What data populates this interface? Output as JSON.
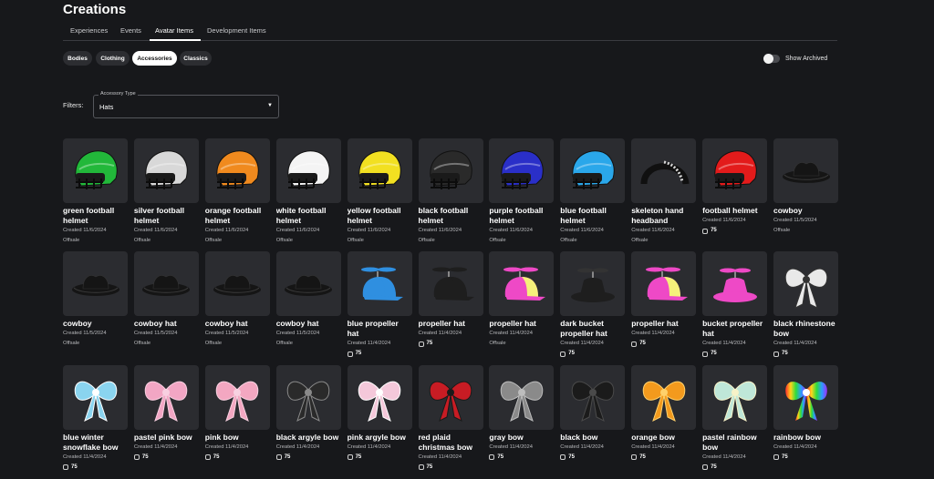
{
  "page": {
    "title": "Creations"
  },
  "tabs": [
    "Experiences",
    "Events",
    "Avatar Items",
    "Development Items"
  ],
  "active_tab": "Avatar Items",
  "categories": [
    "Bodies",
    "Clothing",
    "Accessories",
    "Classics"
  ],
  "active_category": "Accessories",
  "show_archived": {
    "label": "Show Archived",
    "enabled": false
  },
  "filters": {
    "label": "Filters:",
    "select_label": "Accessory Type",
    "select_value": "Hats"
  },
  "items": [
    {
      "name": "green football helmet",
      "created": "Created 11/6/2024",
      "status": "Offsale",
      "icon": "helmet",
      "color": "#22b83a"
    },
    {
      "name": "silver football helmet",
      "created": "Created 11/6/2024",
      "status": "Offsale",
      "icon": "helmet",
      "color": "#d8d8d8"
    },
    {
      "name": "orange football helmet",
      "created": "Created 11/6/2024",
      "status": "Offsale",
      "icon": "helmet",
      "color": "#f08a1e"
    },
    {
      "name": "white football helmet",
      "created": "Created 11/6/2024",
      "status": "Offsale",
      "icon": "helmet",
      "color": "#f4f4f4"
    },
    {
      "name": "yellow football helmet",
      "created": "Created 11/6/2024",
      "status": "Offsale",
      "icon": "helmet",
      "color": "#f2e021"
    },
    {
      "name": "black football helmet",
      "created": "Created 11/6/2024",
      "status": "Offsale",
      "icon": "helmet",
      "color": "#2a2a2a"
    },
    {
      "name": "purple football helmet",
      "created": "Created 11/6/2024",
      "status": "Offsale",
      "icon": "helmet",
      "color": "#2a2fc8"
    },
    {
      "name": "blue football helmet",
      "created": "Created 11/6/2024",
      "status": "Offsale",
      "icon": "helmet",
      "color": "#2aa7ea"
    },
    {
      "name": "skeleton hand headband",
      "created": "Created 11/6/2024",
      "status": "Offsale",
      "icon": "headband",
      "color": "#1a1a1a"
    },
    {
      "name": "football helmet",
      "created": "Created 11/6/2024",
      "price": "75",
      "icon": "helmet",
      "color": "#e31b1b"
    },
    {
      "name": "cowboy",
      "created": "Created 11/5/2024",
      "status": "Offsale",
      "icon": "cowboy",
      "color": "#151515"
    },
    {
      "name": "cowboy",
      "created": "Created 11/5/2024",
      "status": "Offsale",
      "icon": "cowboy",
      "color": "#151515"
    },
    {
      "name": "cowboy hat",
      "created": "Created 11/5/2024",
      "status": "Offsale",
      "icon": "cowboy",
      "color": "#151515"
    },
    {
      "name": "cowboy hat",
      "created": "Created 11/5/2024",
      "status": "Offsale",
      "icon": "cowboy",
      "color": "#151515"
    },
    {
      "name": "cowboy hat",
      "created": "Created 11/5/2024",
      "status": "Offsale",
      "icon": "cowboy",
      "color": "#151515"
    },
    {
      "name": "blue propeller hat",
      "created": "Created 11/4/2024",
      "price": "75",
      "icon": "propeller",
      "color": "#2f8fe0",
      "color2": "#2f8fe0"
    },
    {
      "name": "propeller hat",
      "created": "Created 11/4/2024",
      "price": "75",
      "icon": "propeller",
      "color": "#1e1e1e",
      "color2": "#1e1e1e"
    },
    {
      "name": "propeller hat",
      "created": "Created 11/4/2024",
      "status": "Offsale",
      "icon": "propeller",
      "color": "#ee49c6",
      "color2": "#f5f07a"
    },
    {
      "name": "dark bucket propeller hat",
      "created": "Created 11/4/2024",
      "price": "75",
      "icon": "bucket",
      "color": "#1e1e1e"
    },
    {
      "name": "propeller hat",
      "created": "Created 11/4/2024",
      "price": "75",
      "icon": "propeller",
      "color": "#ee49c6",
      "color2": "#f5f07a"
    },
    {
      "name": "bucket propeller hat",
      "created": "Created 11/4/2024",
      "price": "75",
      "icon": "bucket",
      "color": "#ee49c6"
    },
    {
      "name": "black rhinestone bow",
      "created": "Created 11/4/2024",
      "price": "75",
      "icon": "bow",
      "color": "#e9e9e9",
      "color2": "#333333"
    },
    {
      "name": "blue winter snowflake bow",
      "created": "Created 11/4/2024",
      "price": "75",
      "icon": "bow",
      "color": "#8ad4ef",
      "color2": "#ffffff"
    },
    {
      "name": "pastel pink bow",
      "created": "Created 11/4/2024",
      "price": "75",
      "icon": "bow",
      "color": "#f2a6c4",
      "color2": "#f8cfe0"
    },
    {
      "name": "pink bow",
      "created": "Created 11/4/2024",
      "price": "75",
      "icon": "bow",
      "color": "#f3a7c1",
      "color2": "#f8d2e1"
    },
    {
      "name": "black argyle bow",
      "created": "Created 11/4/2024",
      "price": "75",
      "icon": "bow",
      "color": "#2a2a2a",
      "color2": "#8a8a8a"
    },
    {
      "name": "pink argyle bow",
      "created": "Created 11/4/2024",
      "price": "75",
      "icon": "bow",
      "color": "#f4c8da",
      "color2": "#ffffff"
    },
    {
      "name": "red plaid christmas bow",
      "created": "Created 11/4/2024",
      "price": "75",
      "icon": "bow",
      "color": "#c81c24",
      "color2": "#1a1a1a"
    },
    {
      "name": "gray bow",
      "created": "Created 11/4/2024",
      "price": "75",
      "icon": "bow",
      "color": "#8a8a8a",
      "color2": "#bdbdbd"
    },
    {
      "name": "black bow",
      "created": "Created 11/4/2024",
      "price": "75",
      "icon": "bow",
      "color": "#1b1b1b",
      "color2": "#4a4a4a"
    },
    {
      "name": "orange bow",
      "created": "Created 11/4/2024",
      "price": "75",
      "icon": "bow",
      "color": "#f39a1d",
      "color2": "#ffd16b"
    },
    {
      "name": "pastel rainbow bow",
      "created": "Created 11/4/2024",
      "price": "75",
      "icon": "bow",
      "color": "#bfe7d8",
      "color2": "#f7f2c8"
    },
    {
      "name": "rainbow bow",
      "created": "Created 11/4/2024",
      "price": "75",
      "icon": "rainbow-bow",
      "color": "#ff2d2d",
      "color2": "#2d6bff"
    }
  ]
}
